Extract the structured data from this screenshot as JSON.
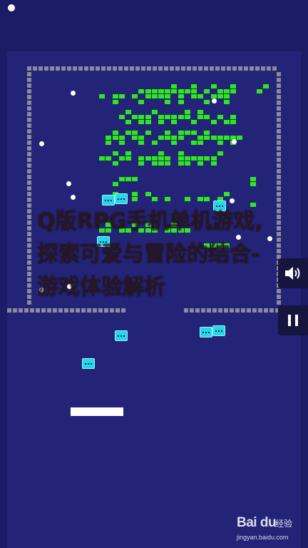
{
  "overlay": {
    "title": "Q版RPG手机单机游戏,探索可爱与冒险的结合-游戏体验解析"
  },
  "controls": {
    "sound_icon": "speaker-icon",
    "pause_icon": "pause-icon"
  },
  "watermark": {
    "brand": "Bai du",
    "tail": "经验",
    "url": "jingyan.baidu.com"
  },
  "colors": {
    "background": "#1c1c66",
    "playfield": "#232378",
    "wall": "#8a8a9c",
    "brick": "#2ee81e",
    "capsule": "#23d8e8",
    "paddle": "#ffffff",
    "ball": "#ffffff",
    "button_bg": "#15153e"
  },
  "bricks": {
    "rows": [
      "............*..*..*..*....*",
      ".......*********.*.***...*.",
      ".*.**.*.****.*.**.***......",
      "...*...*...*.*...*..*......",
      "...........................",
      ".....*...*....*.*..........",
      "....*.***.*****.**.*.*.....",
      ".....*.**.*.*..*..*.**.....",
      "...........................",
      "...*.**.*..*.***.*.........",
      "..***.**..****..*******....",
      "..*.*..*.*..*..**..*.*.....",
      "...........................",
      "...*.*....*..*.....*.......",
      ".**.**.*****.******........",
      "...*...*.***.**.*.*........",
      "...........................",
      "...........................",
      "....***.................*..",
      "...*....................*..",
      "...........................",
      "...*..*.*...........*......",
      "......*..*.*..*.**.*.......",
      "........................*..",
      "...........................",
      "...........................",
      "...........................",
      "..*...*.*...*..............",
      ".**.**.***.****............",
      "...........................",
      "...........................",
      ".................****......"
    ]
  }
}
